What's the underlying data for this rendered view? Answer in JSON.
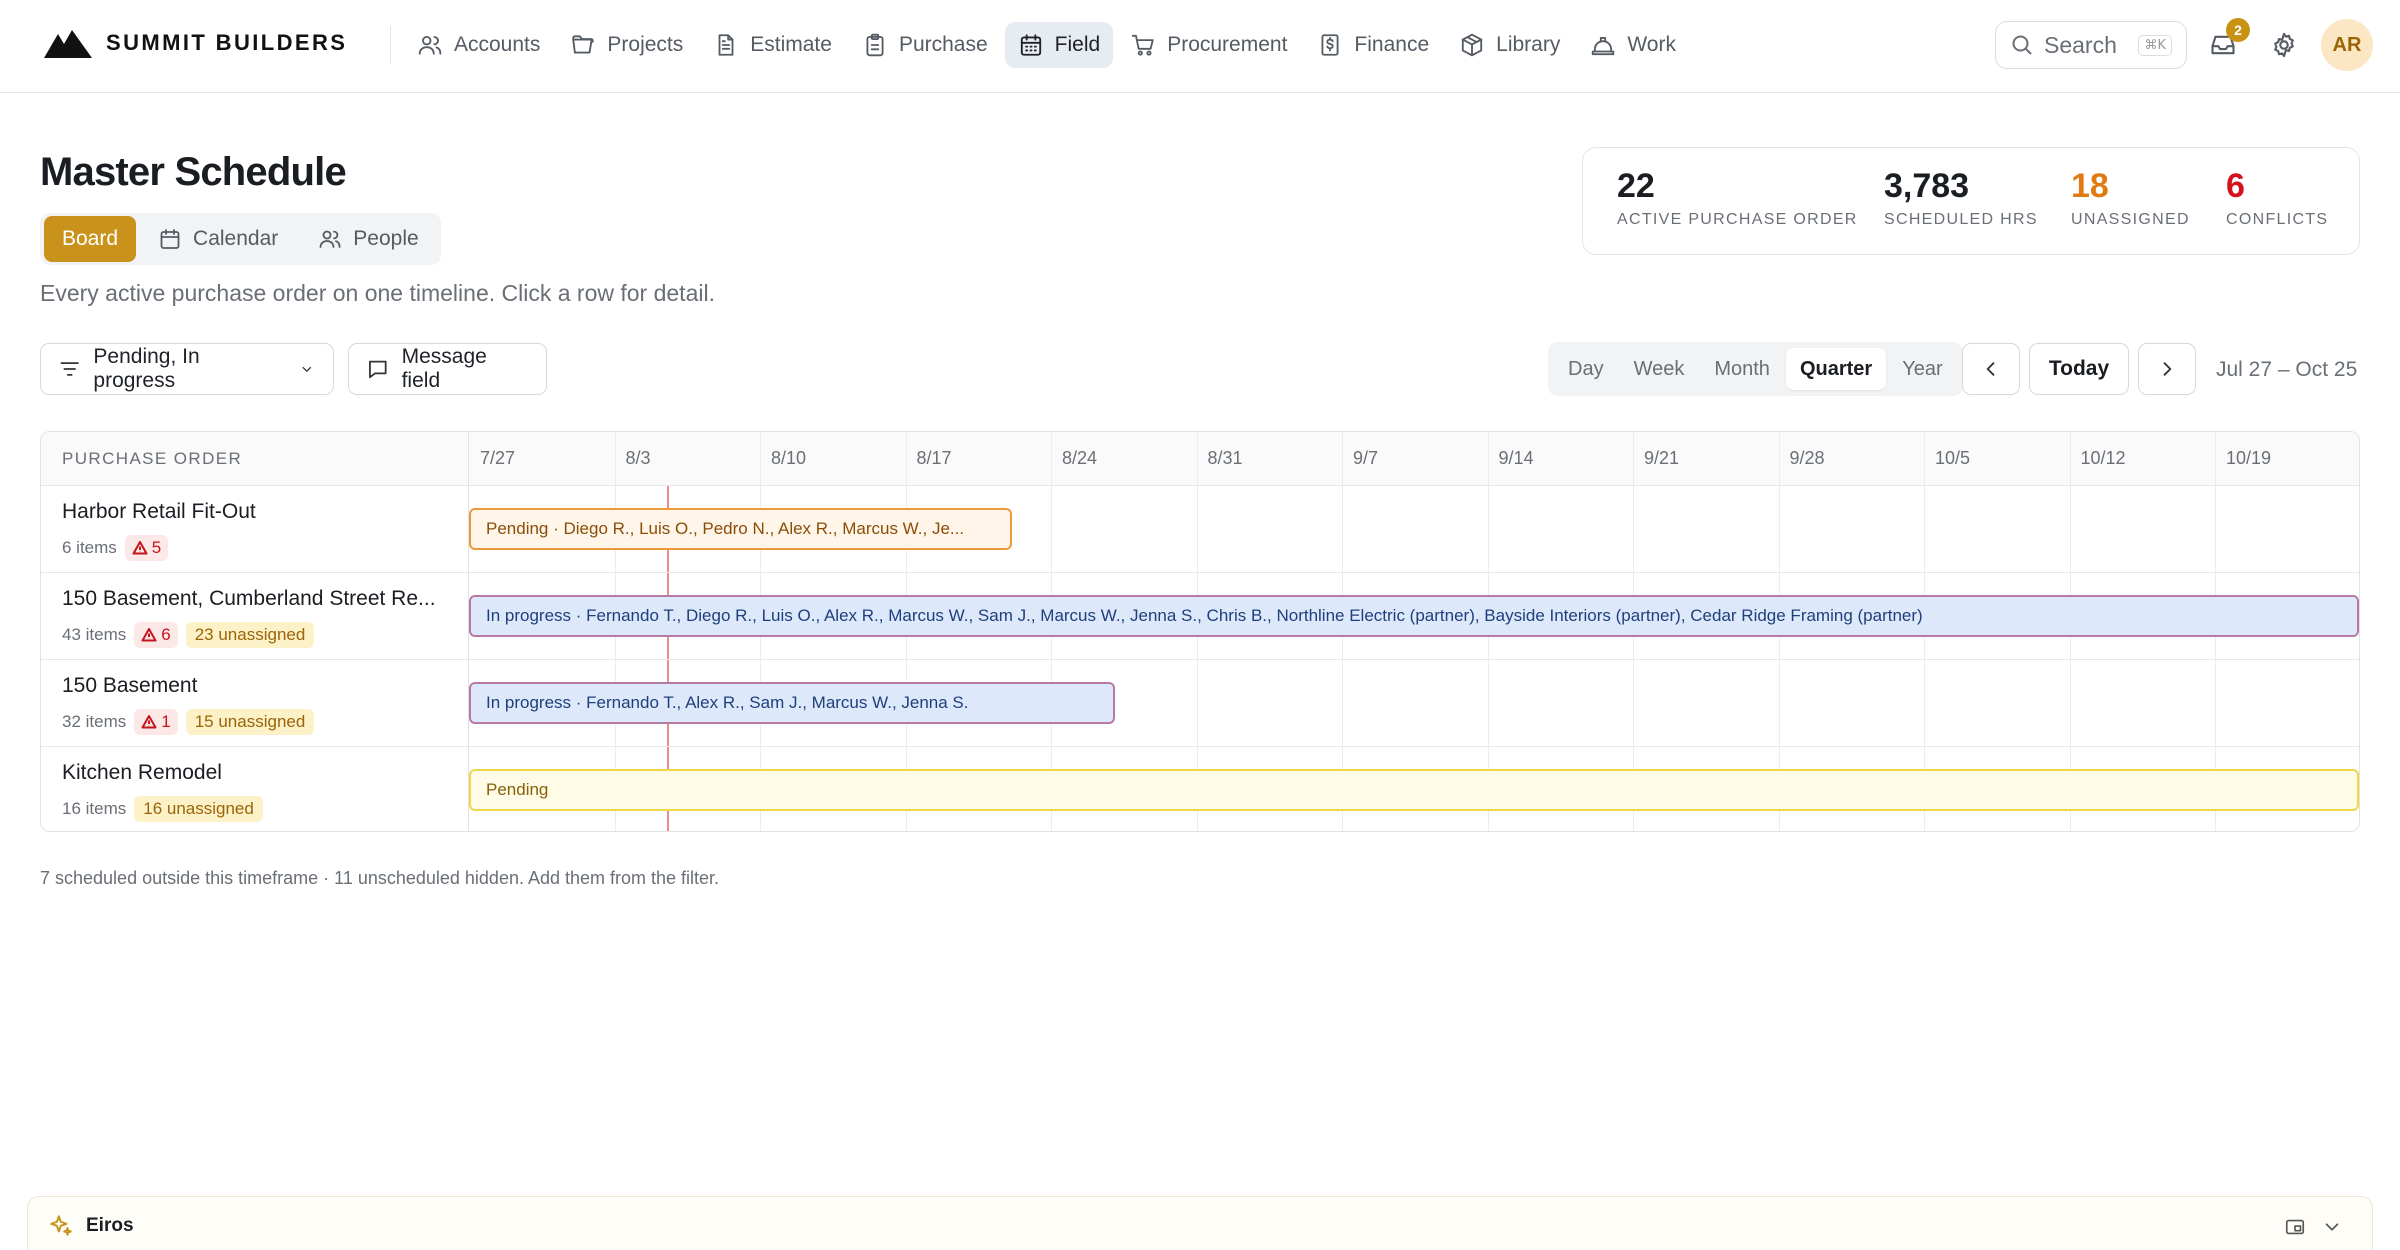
{
  "brand": {
    "name": "SUMMIT BUILDERS"
  },
  "nav": [
    {
      "label": "Accounts",
      "icon": "users-icon"
    },
    {
      "label": "Projects",
      "icon": "folder-icon"
    },
    {
      "label": "Estimate",
      "icon": "document-icon"
    },
    {
      "label": "Purchase",
      "icon": "clipboard-icon"
    },
    {
      "label": "Field",
      "icon": "calendar-icon",
      "active": true
    },
    {
      "label": "Procurement",
      "icon": "cart-icon"
    },
    {
      "label": "Finance",
      "icon": "dollar-doc-icon"
    },
    {
      "label": "Library",
      "icon": "box-icon"
    },
    {
      "label": "Work",
      "icon": "hardhat-icon"
    }
  ],
  "search": {
    "placeholder": "Search",
    "shortcut": "⌘K"
  },
  "notifications": {
    "count": "2"
  },
  "user": {
    "initials": "AR"
  },
  "page": {
    "title": "Master Schedule",
    "subtitle": "Every active purchase order on one timeline. Click a row for detail."
  },
  "view_tabs": [
    {
      "label": "Board",
      "active": true
    },
    {
      "label": "Calendar"
    },
    {
      "label": "People"
    }
  ],
  "stats": [
    {
      "value": "22",
      "label": "ACTIVE PURCHASE ORDER",
      "color": "#1a1d21"
    },
    {
      "value": "3,783",
      "label": "SCHEDULED HRS",
      "color": "#1a1d21"
    },
    {
      "value": "18",
      "label": "UNASSIGNED",
      "color": "#e07b12"
    },
    {
      "value": "6",
      "label": "CONFLICTS",
      "color": "#d5121c"
    }
  ],
  "toolbar": {
    "filter_label": "Pending, In progress",
    "message_label": "Message field",
    "ranges": [
      "Day",
      "Week",
      "Month",
      "Quarter",
      "Year"
    ],
    "active_range": "Quarter",
    "today_label": "Today",
    "range_label": "Jul 27 – Oct 25"
  },
  "gantt": {
    "column_header": "PURCHASE ORDER",
    "weeks": [
      "7/27",
      "8/3",
      "8/10",
      "8/17",
      "8/24",
      "8/31",
      "9/7",
      "9/14",
      "9/21",
      "9/28",
      "10/5",
      "10/12",
      "10/19"
    ],
    "today_marker_color": "#ef8a8a",
    "rows": [
      {
        "name": "Harbor Retail Fit-Out",
        "items": "6 items",
        "conflicts": "5",
        "unassigned": "",
        "bar": {
          "status": "pending",
          "label": "Pending · Diego R., Luis O., Pedro N., Alex R., Marcus W., Je...",
          "start_week": 0,
          "span_weeks": 3.73
        }
      },
      {
        "name": "150 Basement, Cumberland Street Re...",
        "items": "43 items",
        "conflicts": "6",
        "unassigned": "23 unassigned",
        "bar": {
          "status": "progress",
          "label": "In progress · Fernando T., Diego R., Luis O., Alex R., Marcus W., Sam J., Marcus W., Jenna S., Chris B., Northline Electric (partner), Bayside Interiors (partner), Cedar Ridge Framing (partner)",
          "start_week": 0,
          "span_weeks": 13
        }
      },
      {
        "name": "150 Basement",
        "items": "32 items",
        "conflicts": "1",
        "unassigned": "15 unassigned",
        "bar": {
          "status": "progress",
          "label": "In progress · Fernando T., Alex R., Sam J., Marcus W., Jenna S.",
          "start_week": 0,
          "span_weeks": 4.44
        }
      },
      {
        "name": "Kitchen Remodel",
        "items": "16 items",
        "conflicts": "",
        "unassigned": "16 unassigned",
        "bar": {
          "status": "pending-yellow",
          "label": "Pending",
          "start_week": 0,
          "span_weeks": 13
        }
      }
    ]
  },
  "footnote": "7 scheduled outside this timeframe · 11 unscheduled hidden. Add them from the filter.",
  "assistant": {
    "title": "Eiros"
  }
}
